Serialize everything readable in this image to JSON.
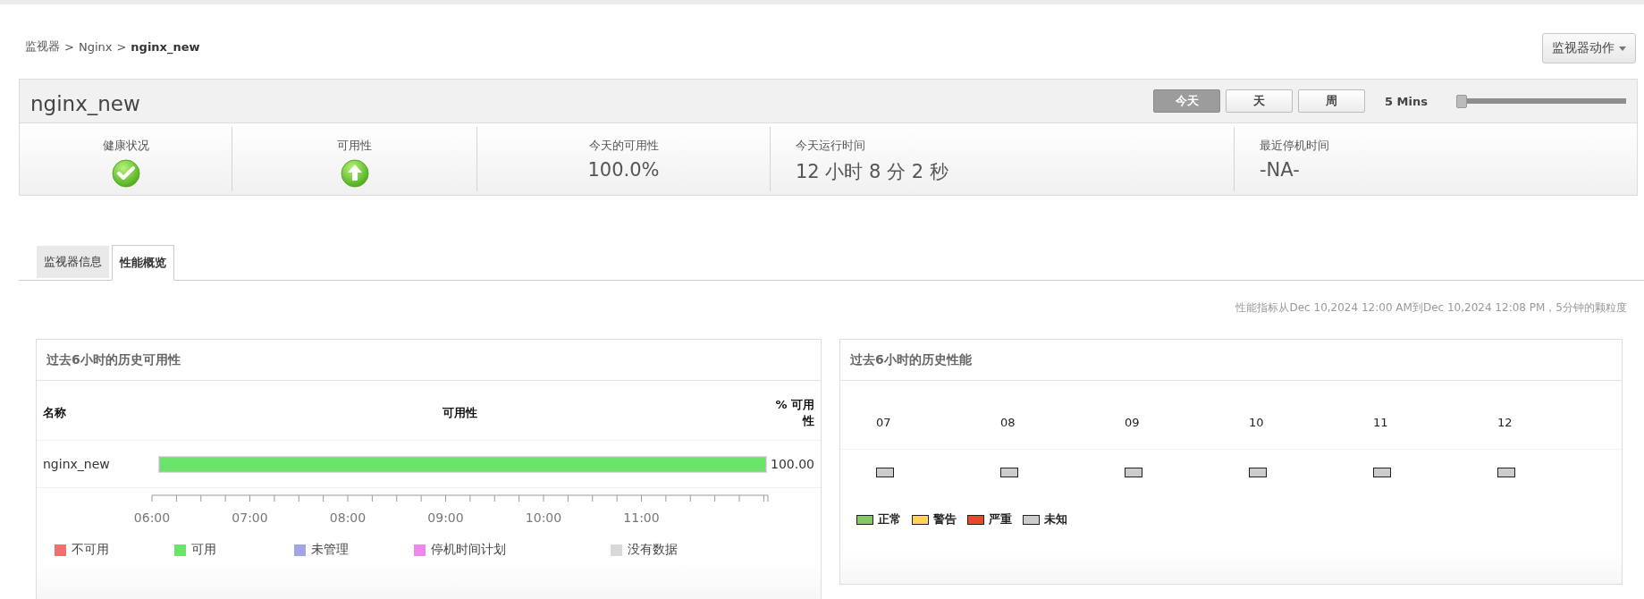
{
  "breadcrumb": [
    {
      "label": "监视器",
      "current": false,
      "separator": ">"
    },
    {
      "label": "Nginx",
      "current": false,
      "separator": ">"
    },
    {
      "label": "nginx_new",
      "current": true
    }
  ],
  "actions_button": {
    "label": "监视器动作"
  },
  "monitor": {
    "name": "nginx_new",
    "periods": [
      {
        "label": "今天",
        "selected": true
      },
      {
        "label": "天",
        "selected": false
      },
      {
        "label": "周",
        "selected": false
      }
    ],
    "interval": {
      "label": "5 Mins",
      "level": 0
    },
    "stats": [
      {
        "kind": "health",
        "label": "健康状况",
        "ok": true
      },
      {
        "kind": "availability",
        "label": "可用性",
        "ok": true
      },
      {
        "kind": "metric",
        "label": "今天的可用性",
        "value": "100.0%"
      },
      {
        "kind": "detail",
        "label": "今天运行时间",
        "value": "12 小时 8 分 2 秒"
      },
      {
        "kind": "detail",
        "label": "最近停机时间",
        "value": "-NA-"
      }
    ]
  },
  "tabs": [
    {
      "label": "监视器信息",
      "selected": false
    },
    {
      "label": "性能概览",
      "selected": true
    }
  ],
  "range_note": "性能指标从Dec 10,2024 12:00 AM到Dec 10,2024 12:08 PM，5分钟的颗粒度",
  "availability": {
    "title": "过去6小时的历史可用性",
    "columns": [
      "名称",
      "可用性",
      "% 可用性"
    ],
    "rows": [
      {
        "name": "nginx_new",
        "level": 1,
        "percent": "100.00"
      }
    ],
    "axis_labels": [
      "06:00",
      "07:00",
      "08:00",
      "09:00",
      "10:00",
      "11:00"
    ],
    "legend": [
      {
        "label": "不可用",
        "color": "#f07070"
      },
      {
        "label": "可用",
        "color": "#6ce46c"
      },
      {
        "label": "未管理",
        "color": "#a4a4ea"
      },
      {
        "label": "停机时间计划",
        "color": "#ee88ee"
      },
      {
        "label": "没有数据",
        "color": "#d9d9d9"
      }
    ]
  },
  "performance": {
    "title": "过去6小时的历史性能",
    "hours": [
      {
        "label": "07",
        "color": "#cccccc"
      },
      {
        "label": "08",
        "color": "#cccccc"
      },
      {
        "label": "09",
        "color": "#cccccc"
      },
      {
        "label": "10",
        "color": "#cccccc"
      },
      {
        "label": "11",
        "color": "#cccccc"
      },
      {
        "label": "12",
        "color": "#cccccc"
      }
    ],
    "legend": [
      {
        "label": "正常",
        "color": "#85c761"
      },
      {
        "label": "警告",
        "color": "#ffd35a"
      },
      {
        "label": "严重",
        "color": "#e8492a"
      },
      {
        "label": "未知",
        "color": "#cccccc"
      }
    ]
  }
}
